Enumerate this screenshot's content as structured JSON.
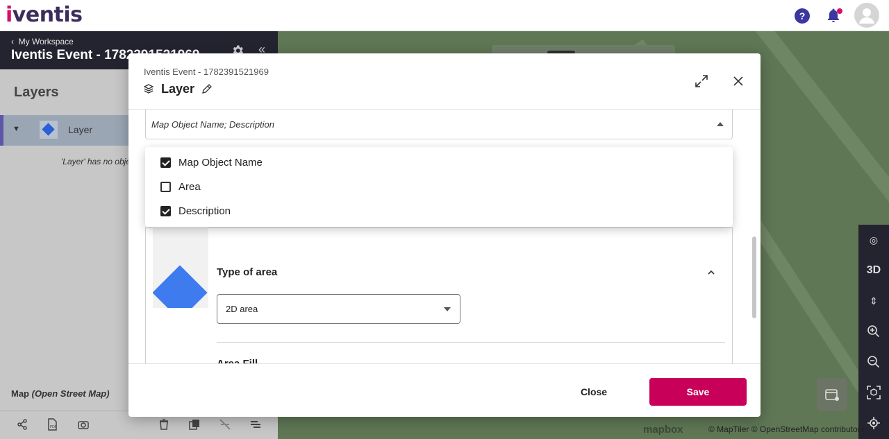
{
  "header": {
    "logo_text": "iventis",
    "help_glyph": "?",
    "icons": [
      "help-icon",
      "bell-icon",
      "avatar-icon"
    ],
    "brand_color": "#d40f67"
  },
  "sidebar": {
    "back_label": "My Workspace",
    "workspace_title": "Iventis Event - 1782391521969",
    "layers_heading": "Layers",
    "layer": {
      "name": "Layer",
      "empty_message": "'Layer' has no objects"
    },
    "basemap_prefix": "Map",
    "basemap_name": "(Open Street Map)"
  },
  "map": {
    "attribution": "© MapTiler © OpenStreetMap contributors",
    "mapbox_label": "mapbox",
    "controls": [
      "camera-icon",
      "3D",
      "pitch-icon",
      "zoom-in-icon",
      "zoom-out-icon",
      "bounds-icon",
      "locate-icon"
    ],
    "controls_3d_label": "3D"
  },
  "dialog": {
    "subtitle": "Iventis Event - 1782391521969",
    "title": "Layer",
    "multi_select_value": "Map Object Name; Description",
    "type_of_area_label": "Type of area",
    "type_of_area_value": "2D area",
    "area_fill_label": "Area Fill",
    "close_label": "Close",
    "save_label": "Save",
    "save_color": "#c9005a"
  },
  "dropdown": {
    "options": [
      {
        "label": "Map Object Name",
        "checked": true
      },
      {
        "label": "Area",
        "checked": false
      },
      {
        "label": "Description",
        "checked": true
      }
    ]
  }
}
